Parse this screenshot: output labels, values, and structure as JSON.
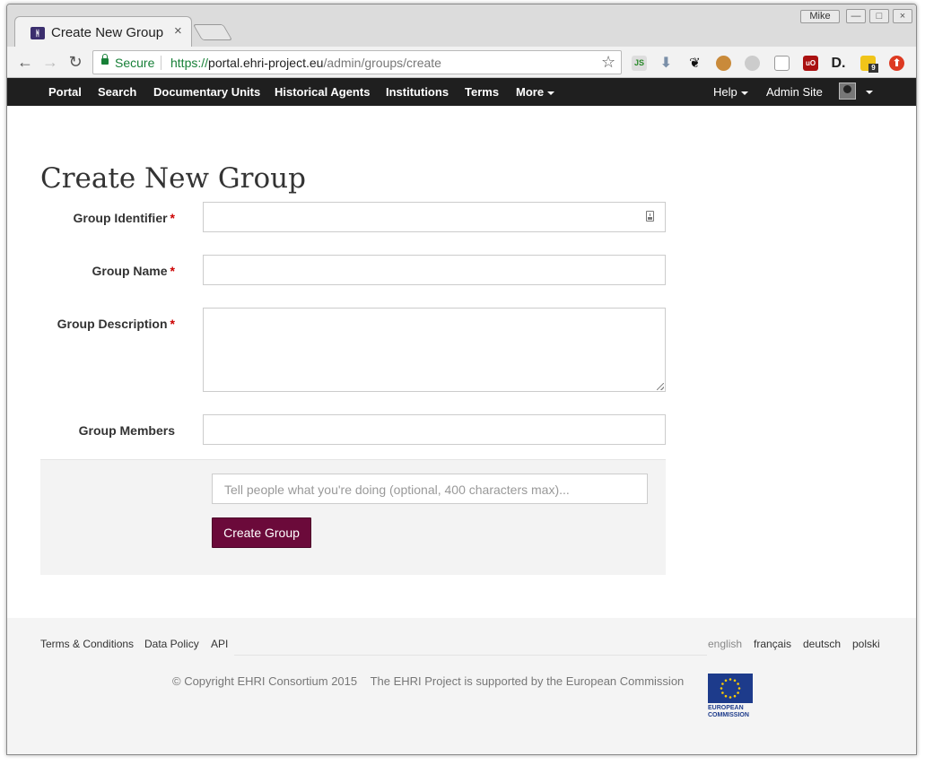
{
  "browser": {
    "tab_title": "Create New Group",
    "tab_close": "×",
    "profile_name": "Mike",
    "secure_label": "Secure",
    "url_protocol": "https://",
    "url_host": "portal.ehri-project.eu",
    "url_path": "/admin/groups/create",
    "extension_badge": "9",
    "window_controls": [
      "—",
      "□",
      "×"
    ]
  },
  "nav": {
    "items": [
      "Portal",
      "Search",
      "Documentary Units",
      "Historical Agents",
      "Institutions",
      "Terms",
      "More"
    ],
    "right": {
      "help": "Help",
      "admin": "Admin Site"
    }
  },
  "page": {
    "title": "Create New Group"
  },
  "form": {
    "identifier": {
      "label": "Group Identifier",
      "required_mark": "*",
      "value": ""
    },
    "name": {
      "label": "Group Name",
      "required_mark": "*",
      "value": ""
    },
    "description": {
      "label": "Group Description",
      "required_mark": "*",
      "value": ""
    },
    "members": {
      "label": "Group Members",
      "value": ""
    },
    "log_message": {
      "placeholder": "Tell people what you're doing (optional, 400 characters max)...",
      "value": ""
    },
    "submit_label": "Create Group"
  },
  "footer": {
    "links": [
      "Terms & Conditions",
      "Data Policy",
      "API"
    ],
    "languages": [
      "english",
      "français",
      "deutsch",
      "polski"
    ],
    "active_language": "english",
    "copyright": "© Copyright EHRI Consortium 2015",
    "support": "The EHRI Project is supported by the European Commission",
    "eu_logo_text": [
      "EUROPEAN",
      "COMMISSION"
    ]
  },
  "colors": {
    "nav_bg": "#1f1f1f",
    "accent_button": "#6b0a3a",
    "required": "#cc0000",
    "secure_green": "#188038",
    "eu_blue": "#1d3b8b",
    "eu_star": "#ffcc00"
  }
}
